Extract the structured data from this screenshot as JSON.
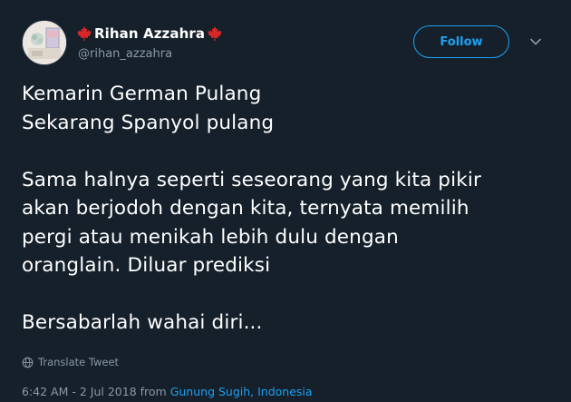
{
  "author": {
    "display_name": "Rihan Azzahra",
    "handle": "@rihan_azzahra"
  },
  "header": {
    "follow_label": "Follow",
    "menu_icon": "chevron-down-icon"
  },
  "tweet": {
    "lines": [
      "Kemarin German Pulang",
      "Sekarang Spanyol pulang",
      "",
      "Sama halnya seperti seseorang yang kita pikir",
      "akan berjodoh dengan kita, ternyata memilih",
      "pergi atau menikah lebih dulu dengan",
      "oranglain. Diluar prediksi",
      "",
      "Bersabarlah wahai diri..."
    ]
  },
  "translate_label": "Translate Tweet",
  "meta": {
    "time": "6:42 AM",
    "separator": " - ",
    "date": "2 Jul 2018",
    "from_label": " from ",
    "location": "Gunung Sugih, Indonesia"
  },
  "colors": {
    "background": "#15202b",
    "accent": "#1da1f2",
    "secondary_text": "#8899a6",
    "maple_leaf": "#d62828"
  }
}
